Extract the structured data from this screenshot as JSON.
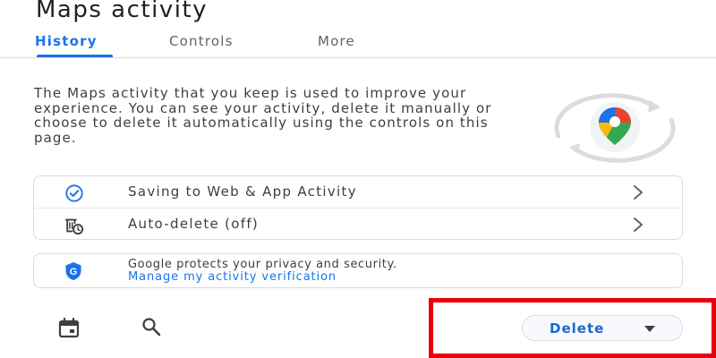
{
  "header": {
    "title": "Maps activity"
  },
  "tabs": [
    {
      "label": "History",
      "active": true
    },
    {
      "label": "Controls",
      "active": false
    },
    {
      "label": "More",
      "active": false
    }
  ],
  "intro": {
    "text": "The Maps activity that you keep is used to improve your experience. You can see your activity, delete it manually or choose to delete it automatically using the controls on this page."
  },
  "settings": {
    "items": [
      {
        "label": "Saving to Web & App Activity",
        "icon": "check-circle-icon"
      },
      {
        "label": "Auto-delete (off)",
        "icon": "auto-delete-icon"
      }
    ]
  },
  "privacy": {
    "text": "Google protects your privacy and security.",
    "link": "Manage my activity verification",
    "icon": "google-shield-icon"
  },
  "toolbar": {
    "calendar_icon": "calendar-icon",
    "search_icon": "search-icon",
    "delete_label": "Delete"
  },
  "colors": {
    "accent": "#1a73e8",
    "highlight": "#e8000d",
    "text": "#3c4043",
    "border": "#dadce0"
  }
}
